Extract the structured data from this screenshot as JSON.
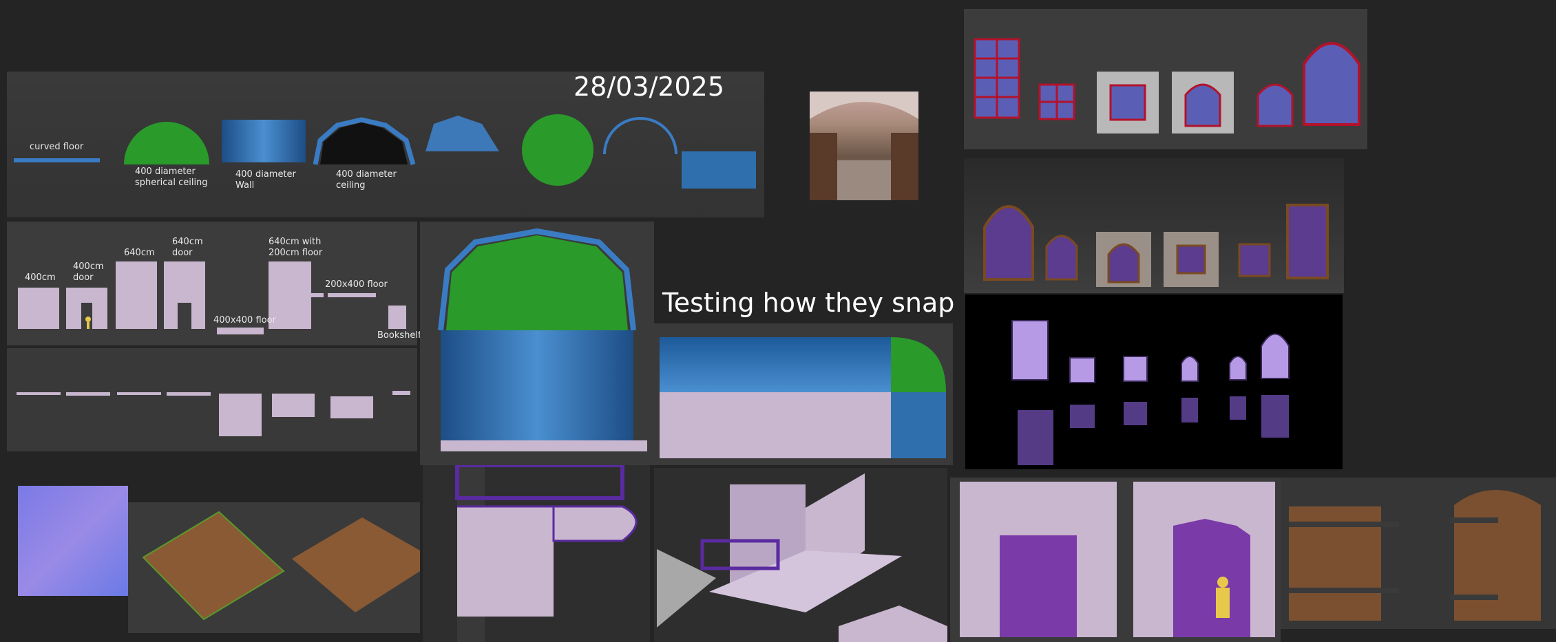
{
  "date_text": "28/03/2025",
  "snap_heading": "Testing how they snap",
  "top_panel": {
    "labels": {
      "curved_floor": "curved floor",
      "spherical_ceiling": "400 diameter\nspherical ceiling",
      "wall": "400 diameter\nWall",
      "ceiling": "400 diameter\nceiling"
    }
  },
  "modules_panel": {
    "labels": {
      "w400": "400cm",
      "w400door": "400cm\ndoor",
      "w640": "640cm",
      "w640door": "640cm\ndoor",
      "w640floor": "640cm with\n200cm floor",
      "floor200x400": "200x400 floor",
      "floor400x400": "400x400 floor",
      "bookshelf": "Bookshelf"
    }
  },
  "colors": {
    "background": "#242424",
    "panel": "#393939",
    "module_pink": "#c9b6cf",
    "dome_green": "#2e9a2e",
    "wall_blue": "#2f6fae",
    "door_purple": "#7a3aa8",
    "window_red": "#b3122a",
    "window_glass": "#6a63b5",
    "wood": "#8a5a34"
  }
}
